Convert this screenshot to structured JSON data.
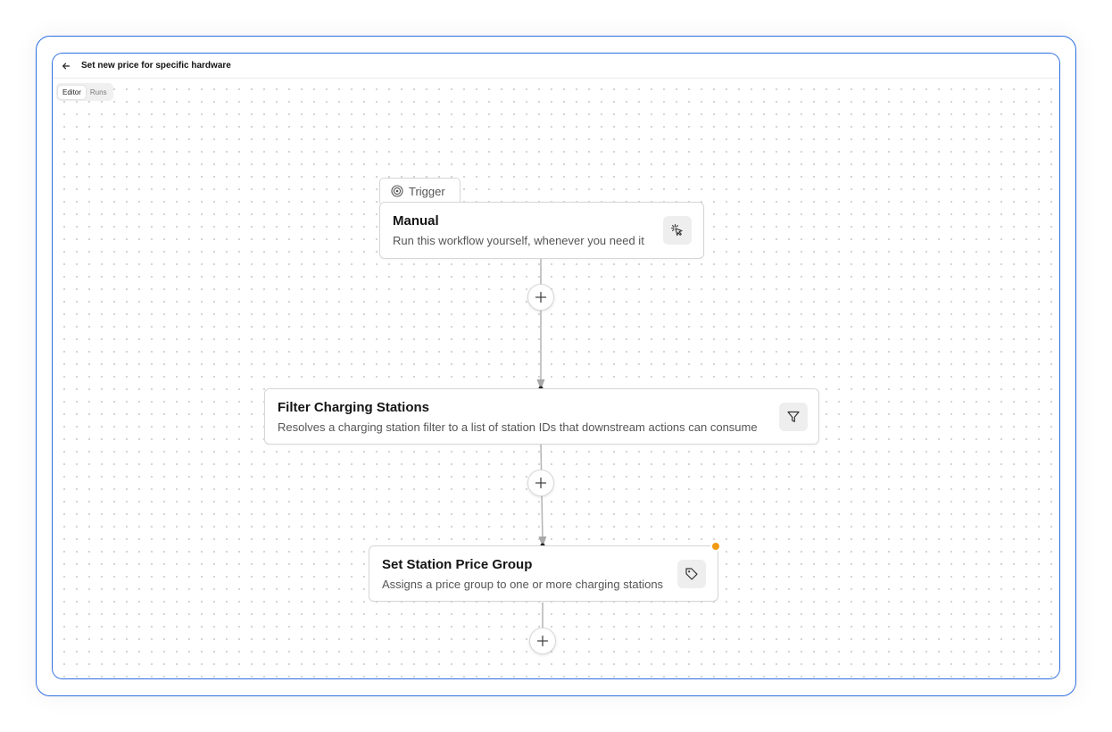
{
  "window": {
    "title": "Set new price for specific hardware"
  },
  "tabs": [
    {
      "label": "Editor",
      "active": true
    },
    {
      "label": "Runs",
      "active": false
    }
  ],
  "nodes": {
    "trigger": {
      "tab_label": "Trigger",
      "title": "Manual",
      "description": "Run this workflow yourself, whenever you need it",
      "icon": "pointer-click-icon"
    },
    "filter": {
      "title": "Filter Charging Stations",
      "description": "Resolves a charging station filter to a list of station IDs that downstream actions can consume",
      "icon": "funnel-icon"
    },
    "price_group": {
      "title": "Set Station Price Group",
      "description": "Assigns a price group to one or more charging stations",
      "icon": "tag-icon",
      "status_color": "#f29a12"
    }
  },
  "colors": {
    "accent_border": "#2f6fe0",
    "warning": "#f29a12"
  }
}
